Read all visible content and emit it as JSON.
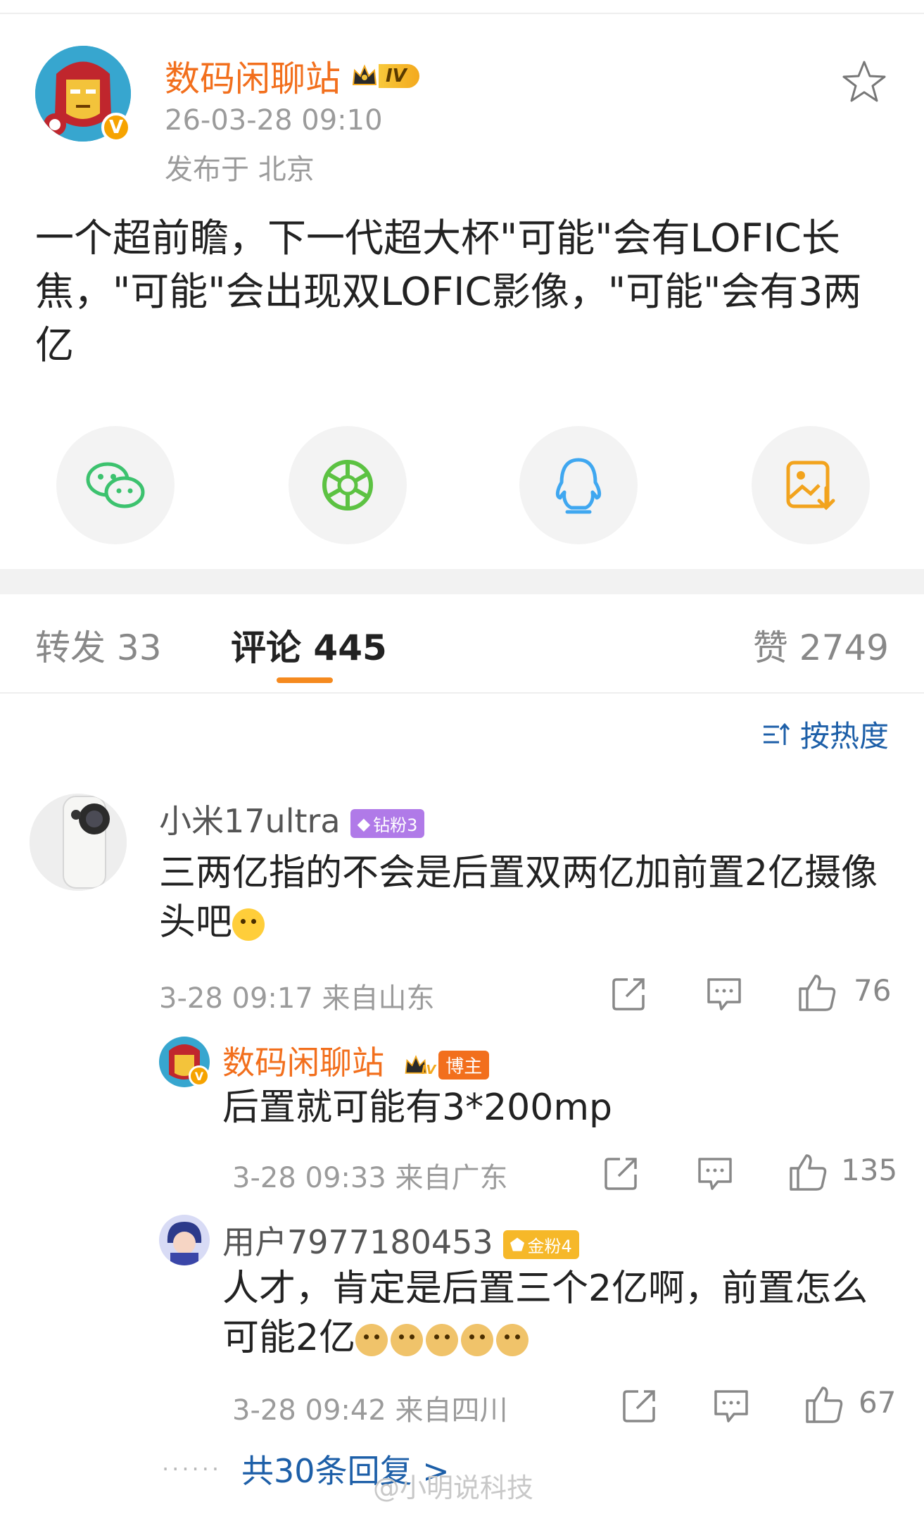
{
  "post": {
    "author": "数码闲聊站",
    "level": "IV",
    "time": "26-03-28 09:10",
    "location": "发布于 北京",
    "text": "一个超前瞻，下一代超大杯\"可能\"会有LOFIC长焦，\"可能\"会出现双LOFIC影像，\"可能\"会有3两亿"
  },
  "share_icons": [
    "wechat-icon",
    "moments-icon",
    "qq-icon",
    "save-image-icon"
  ],
  "tabs": {
    "repost": "转发 33",
    "comments": "评论 445",
    "likes": "赞 2749"
  },
  "sort_label": "按热度",
  "comments": [
    {
      "name": "小米17ultra",
      "badge": "钻粉3",
      "text": "三两亿指的不会是后置双两亿加前置2亿摄像头吧",
      "time": "3-28 09:17 来自山东",
      "likes": "76"
    }
  ],
  "replies": [
    {
      "name": "数码闲聊站",
      "level": "IV",
      "badge": "博主",
      "text": "后置就可能有3*200mp",
      "time": "3-28 09:33 来自广东",
      "likes": "135"
    },
    {
      "name": "用户7977180453",
      "badge": "金粉4",
      "text": "人才，肯定是后置三个2亿啊，前置怎么可能2亿",
      "time": "3-28 09:42 来自四川",
      "likes": "67"
    }
  ],
  "more_replies": "共30条回复 >",
  "more_dots": "······",
  "watermark": "@小明说科技",
  "colors": {
    "accent_orange": "#f26f1d",
    "link_blue": "#1d5fa8",
    "diamond_purple": "#b07ae8",
    "gold_badge": "#f6b829"
  }
}
